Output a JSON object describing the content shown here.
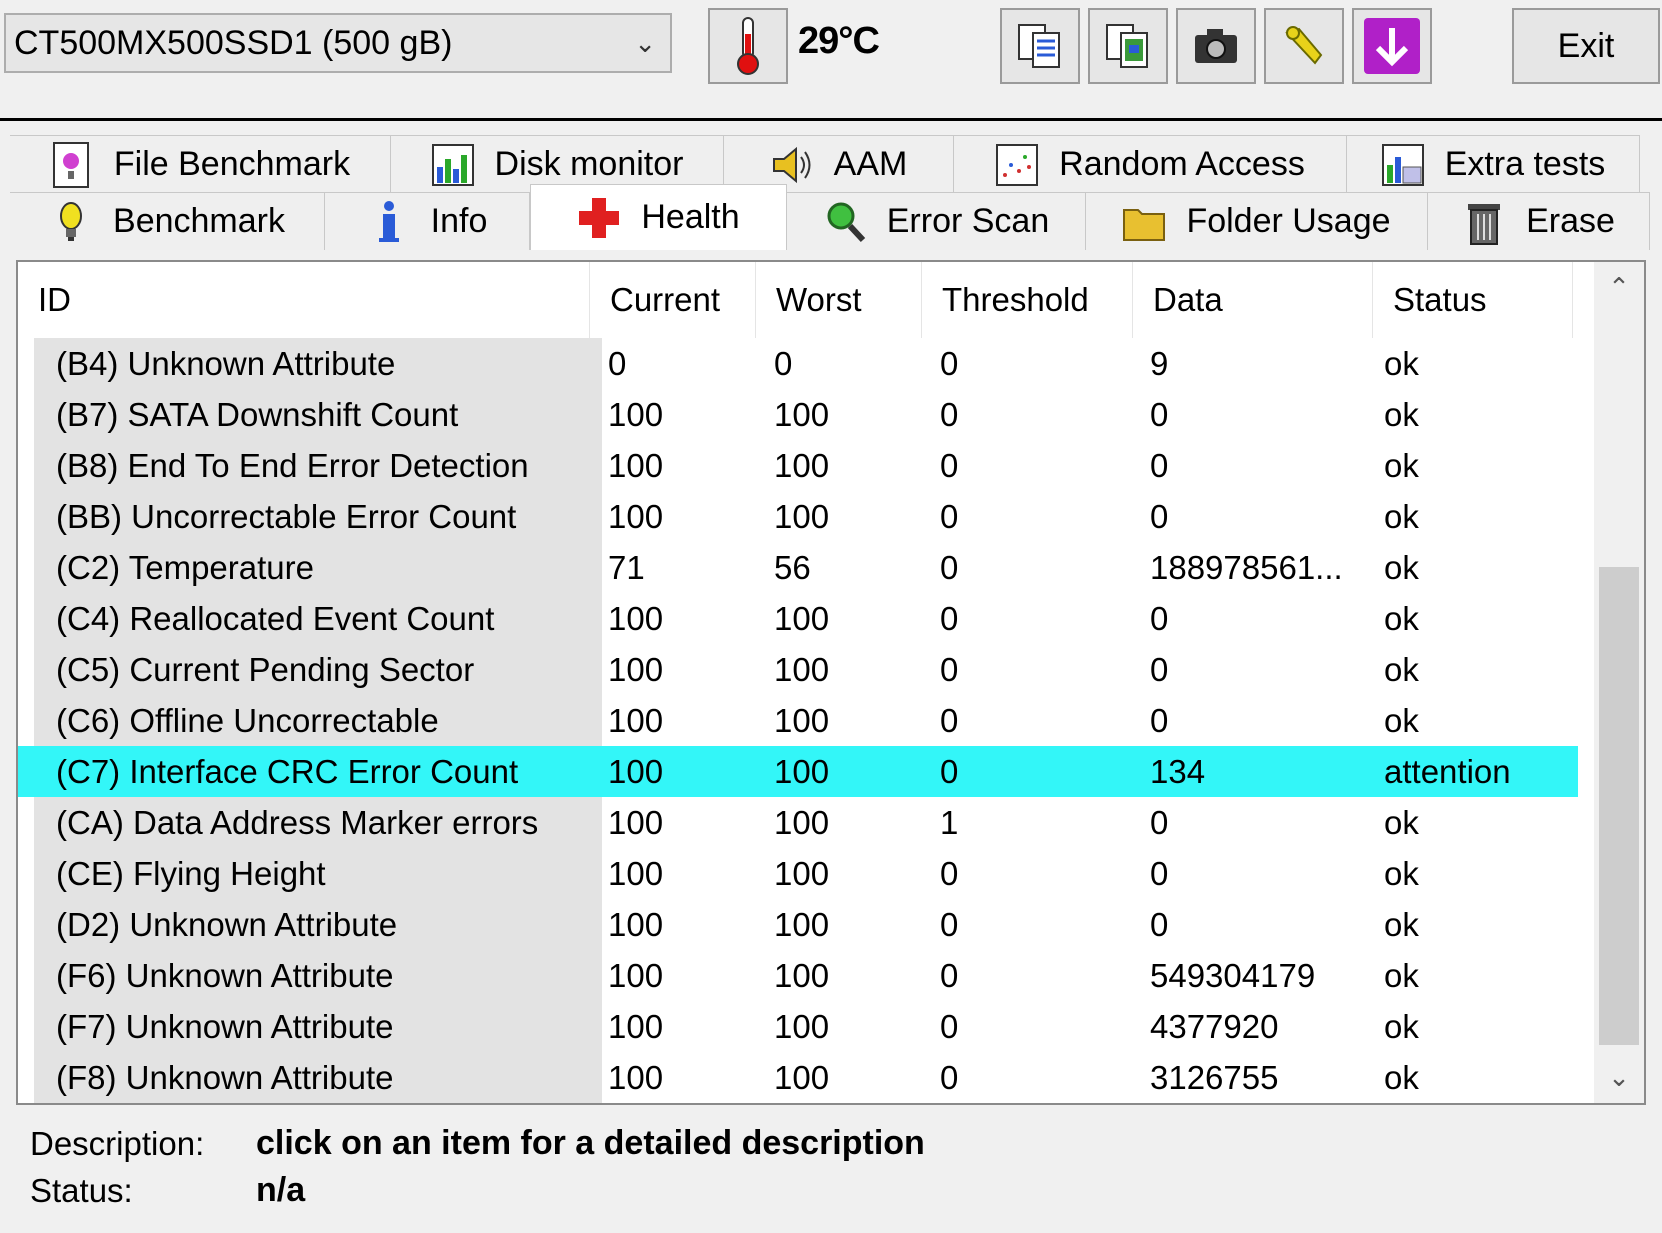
{
  "drive": {
    "selected": "CT500MX500SSD1 (500 gB)"
  },
  "temperature": "29°C",
  "toolbar": {
    "buttons": [
      {
        "name": "copy-text-icon"
      },
      {
        "name": "copy-image-icon"
      },
      {
        "name": "screenshot-camera-icon"
      },
      {
        "name": "options-wrench-icon"
      },
      {
        "name": "download-arrow-icon"
      }
    ],
    "exit_label": "Exit"
  },
  "tabs": {
    "row1": [
      {
        "label": "File Benchmark",
        "icon": "file-benchmark-icon"
      },
      {
        "label": "Disk monitor",
        "icon": "disk-monitor-icon"
      },
      {
        "label": "AAM",
        "icon": "speaker-icon"
      },
      {
        "label": "Random Access",
        "icon": "random-access-icon"
      },
      {
        "label": "Extra tests",
        "icon": "extra-tests-icon"
      }
    ],
    "row2": [
      {
        "label": "Benchmark",
        "icon": "lightbulb-icon"
      },
      {
        "label": "Info",
        "icon": "info-icon"
      },
      {
        "label": "Health",
        "icon": "health-cross-icon",
        "active": true
      },
      {
        "label": "Error Scan",
        "icon": "magnifier-icon"
      },
      {
        "label": "Folder Usage",
        "icon": "folder-icon"
      },
      {
        "label": "Erase",
        "icon": "trash-icon"
      }
    ]
  },
  "table": {
    "headers": [
      "ID",
      "Current",
      "Worst",
      "Threshold",
      "Data",
      "Status"
    ],
    "rows": [
      [
        "(B4) Unknown Attribute",
        "0",
        "0",
        "0",
        "9",
        "ok"
      ],
      [
        "(B7) SATA Downshift Count",
        "100",
        "100",
        "0",
        "0",
        "ok"
      ],
      [
        "(B8) End To End Error Detection",
        "100",
        "100",
        "0",
        "0",
        "ok"
      ],
      [
        "(BB) Uncorrectable Error Count",
        "100",
        "100",
        "0",
        "0",
        "ok"
      ],
      [
        "(C2) Temperature",
        "71",
        "56",
        "0",
        "188978561...",
        "ok"
      ],
      [
        "(C4) Reallocated Event Count",
        "100",
        "100",
        "0",
        "0",
        "ok"
      ],
      [
        "(C5) Current Pending Sector",
        "100",
        "100",
        "0",
        "0",
        "ok"
      ],
      [
        "(C6) Offline Uncorrectable",
        "100",
        "100",
        "0",
        "0",
        "ok"
      ],
      [
        "(C7) Interface CRC Error Count",
        "100",
        "100",
        "0",
        "134",
        "attention"
      ],
      [
        "(CA) Data Address Marker errors",
        "100",
        "100",
        "1",
        "0",
        "ok"
      ],
      [
        "(CE) Flying Height",
        "100",
        "100",
        "0",
        "0",
        "ok"
      ],
      [
        "(D2) Unknown Attribute",
        "100",
        "100",
        "0",
        "0",
        "ok"
      ],
      [
        "(F6) Unknown Attribute",
        "100",
        "100",
        "0",
        "549304179",
        "ok"
      ],
      [
        "(F7) Unknown Attribute",
        "100",
        "100",
        "0",
        "4377920",
        "ok"
      ],
      [
        "(F8) Unknown Attribute",
        "100",
        "100",
        "0",
        "3126755",
        "ok"
      ]
    ],
    "selected_row_index": 8,
    "highlight_color": "#33f6f8"
  },
  "details": {
    "description_label": "Description:",
    "description_value": "click on an item for a detailed description",
    "status_label": "Status:",
    "status_value": "n/a"
  }
}
